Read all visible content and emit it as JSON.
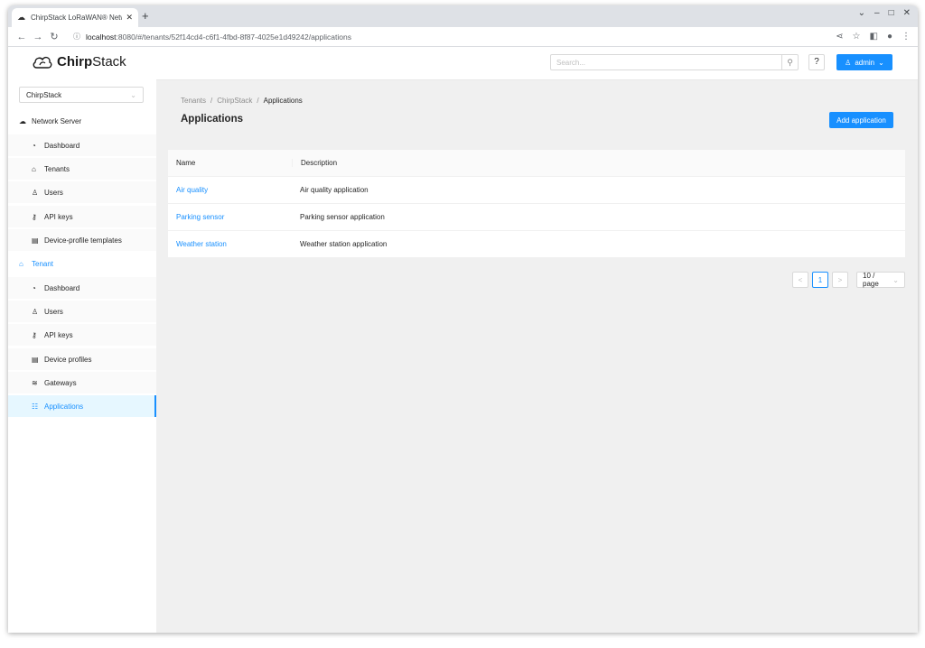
{
  "browser": {
    "tab_title": "ChirpStack LoRaWAN® Netw...",
    "url_host": "localhost",
    "url_path": ":8080/#/tenants/52f14cd4-c6f1-4fbd-8f87-4025e1d49242/applications"
  },
  "header": {
    "logo_bold": "Chirp",
    "logo_light": "Stack",
    "search_placeholder": "Search...",
    "help_label": "?",
    "admin_label": "admin"
  },
  "sidebar": {
    "tenant_select": "ChirpStack",
    "network_server_label": "Network Server",
    "network_items": [
      {
        "label": "Dashboard",
        "icon": "dashboard-icon"
      },
      {
        "label": "Tenants",
        "icon": "home-icon"
      },
      {
        "label": "Users",
        "icon": "user-icon"
      },
      {
        "label": "API keys",
        "icon": "key-icon"
      },
      {
        "label": "Device-profile templates",
        "icon": "template-icon"
      }
    ],
    "tenant_label": "Tenant",
    "tenant_items": [
      {
        "label": "Dashboard",
        "icon": "dashboard-icon"
      },
      {
        "label": "Users",
        "icon": "user-icon"
      },
      {
        "label": "API keys",
        "icon": "key-icon"
      },
      {
        "label": "Device profiles",
        "icon": "device-profile-icon"
      },
      {
        "label": "Gateways",
        "icon": "wifi-icon"
      },
      {
        "label": "Applications",
        "icon": "applications-icon"
      }
    ]
  },
  "main": {
    "breadcrumb": [
      "Tenants",
      "ChirpStack",
      "Applications"
    ],
    "page_title": "Applications",
    "add_button": "Add application",
    "table": {
      "columns": [
        "Name",
        "Description"
      ],
      "rows": [
        {
          "name": "Air quality",
          "description": "Air quality application"
        },
        {
          "name": "Parking sensor",
          "description": "Parking sensor application"
        },
        {
          "name": "Weather station",
          "description": "Weather station application"
        }
      ]
    },
    "pagination": {
      "prev": "<",
      "current_page": "1",
      "next": ">",
      "page_size": "10 / page"
    }
  },
  "colors": {
    "accent": "#1890ff",
    "content_bg": "#f0f0f0",
    "active_menu_bg": "#e6f7ff"
  }
}
